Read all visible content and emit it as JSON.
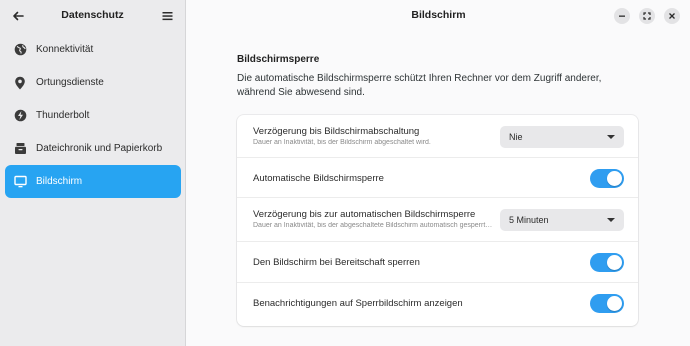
{
  "sidebar": {
    "title": "Datenschutz",
    "items": [
      {
        "label": "Konnektivität",
        "icon": "globe-icon"
      },
      {
        "label": "Ortungsdienste",
        "icon": "location-pin-icon"
      },
      {
        "label": "Thunderbolt",
        "icon": "thunderbolt-icon"
      },
      {
        "label": "Dateichronik und Papierkorb",
        "icon": "file-cabinet-icon"
      },
      {
        "label": "Bildschirm",
        "icon": "monitor-icon",
        "active": true
      }
    ]
  },
  "header": {
    "title": "Bildschirm"
  },
  "section": {
    "title": "Bildschirmsperre",
    "description": "Die automatische Bildschirmsperre schützt Ihren Rechner vor dem Zugriff anderer, während Sie abwesend sind."
  },
  "settings": {
    "blank_delay": {
      "title": "Verzögerung bis Bildschirmabschaltung",
      "subtitle": "Dauer an Inaktivität, bis der Bildschirm abgeschaltet wird.",
      "value": "Nie"
    },
    "auto_lock": {
      "title": "Automatische Bildschirmsperre",
      "enabled": true
    },
    "lock_delay": {
      "title": "Verzögerung bis zur automatischen Bildschirmsperre",
      "subtitle": "Dauer an Inaktivität, bis der abgeschaltete Bildschirm automatisch gesperrt wird.",
      "value": "5 Minuten"
    },
    "lock_on_suspend": {
      "title": "Den Bildschirm bei Bereitschaft sperren",
      "enabled": true
    },
    "lock_notifications": {
      "title": "Benachrichtigungen auf Sperrbildschirm anzeigen",
      "enabled": true
    }
  },
  "colors": {
    "accent": "#27a4f2",
    "toggle_on": "#2f9df0"
  }
}
